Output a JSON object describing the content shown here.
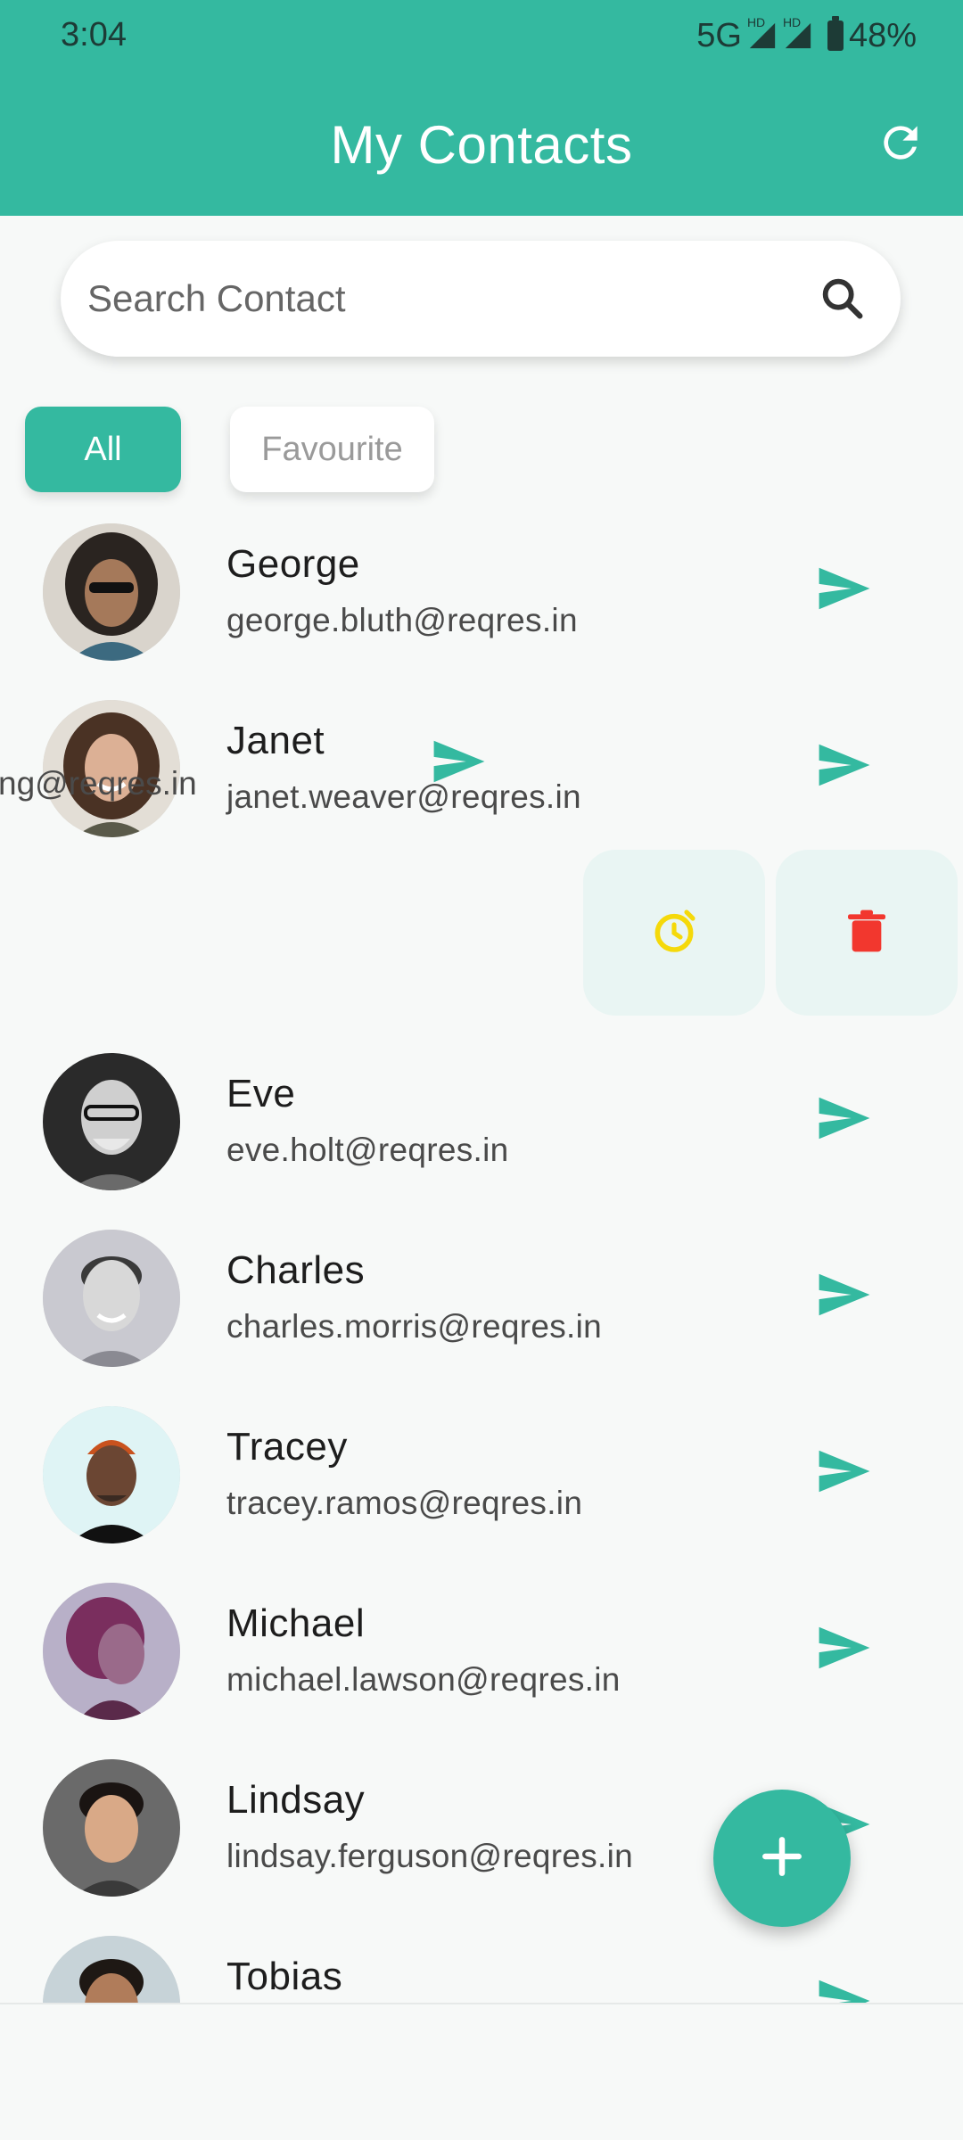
{
  "status_bar": {
    "time": "3:04",
    "network": "5G",
    "hd": "HD",
    "battery": "48%"
  },
  "header": {
    "title": "My Contacts",
    "refresh_icon": "refresh-icon"
  },
  "search": {
    "placeholder": "Search Contact",
    "value": "",
    "icon": "search-icon"
  },
  "filters": {
    "all": "All",
    "favourite": "Favourite"
  },
  "contacts": [
    {
      "name": "George",
      "email": "george.bluth@reqres.in"
    },
    {
      "name": "Janet",
      "email": "janet.weaver@reqres.in"
    },
    {
      "name": "",
      "email": "ng@reqres.in"
    },
    {
      "name": "Eve",
      "email": "eve.holt@reqres.in"
    },
    {
      "name": "Charles",
      "email": "charles.morris@reqres.in"
    },
    {
      "name": "Tracey",
      "email": "tracey.ramos@reqres.in"
    },
    {
      "name": "Michael",
      "email": "michael.lawson@reqres.in"
    },
    {
      "name": "Lindsay",
      "email": "lindsay.ferguson@reqres.in"
    },
    {
      "name": "Tobias",
      "email": ""
    }
  ],
  "swipe_actions": {
    "snooze_icon": "alarm-icon",
    "delete_icon": "trash-icon"
  },
  "fab": {
    "icon": "plus-icon"
  },
  "colors": {
    "primary": "#34b9a0",
    "snooze": "#f5d90a",
    "delete": "#f2372e",
    "action_bg": "#e9f5f3"
  }
}
